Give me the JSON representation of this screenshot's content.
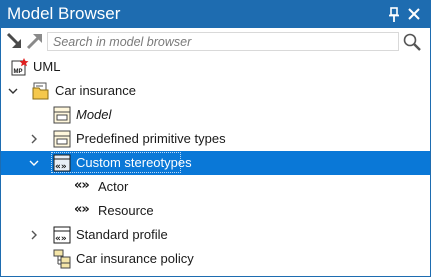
{
  "window": {
    "title": "Model Browser"
  },
  "toolbar": {
    "search_placeholder": "Search in model browser"
  },
  "tree": {
    "uml": {
      "label": "UML",
      "icon": "mp-profile-icon"
    },
    "car_insurance": {
      "label": "Car insurance",
      "icon": "package-icon"
    },
    "model": {
      "label": "Model",
      "icon": "model-icon"
    },
    "predefined": {
      "label": "Predefined primitive types",
      "icon": "model-icon"
    },
    "custom": {
      "label": "Custom stereotypes",
      "icon": "stereotype-package-icon"
    },
    "actor": {
      "label": "Actor",
      "glyph": "«»"
    },
    "resource": {
      "label": "Resource",
      "glyph": "«»"
    },
    "standard": {
      "label": "Standard profile",
      "icon": "stereotype-package-icon"
    },
    "policy": {
      "label": "Car insurance policy",
      "icon": "diagram-icon"
    }
  },
  "colors": {
    "accent": "#1e6cb0",
    "selection": "#0a78d7",
    "folder": "#f5c84c"
  }
}
